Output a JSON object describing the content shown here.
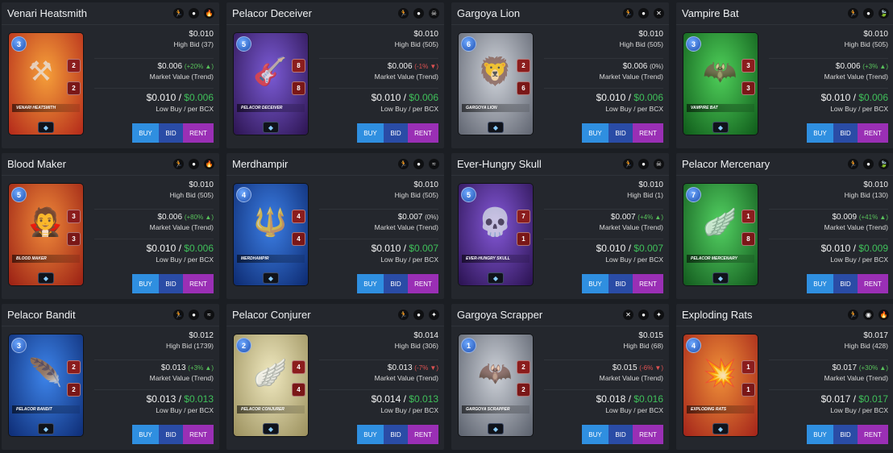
{
  "labels": {
    "high_bid": "High Bid",
    "market_value": "Market Value (Trend)",
    "low_buy": "Low Buy / per BCX",
    "buy": "BUY",
    "bid": "BID",
    "rent": "RENT"
  },
  "colors": {
    "background": "#1b1e23",
    "panel": "#24272d",
    "trend_up": "#58c25b",
    "trend_down": "#e05252",
    "buy": "#2f8fe0",
    "bid": "#2a4ca6",
    "rent": "#9a2fb5"
  },
  "cards": [
    {
      "name": "Venari Heatsmith",
      "art_label": "VENARI HEATSMITH",
      "mana": "3",
      "attack": "2",
      "health": "2",
      "element": "fire",
      "frame": [
        "#f6a03a",
        "#b3281a"
      ],
      "glyph": "⚒",
      "icons": [
        "runner-icon",
        "shield-icon",
        "fire-icon"
      ],
      "price": "$0.010",
      "high_bid": "High Bid (37)",
      "market_value": "$0.006",
      "trend": "(+20% ▲)",
      "trend_dir": "up",
      "low_buy": "$0.010 /",
      "low_buy_bcx": "$0.006"
    },
    {
      "name": "Pelacor Deceiver",
      "art_label": "PELACOR DECEIVER",
      "mana": "5",
      "attack": "8",
      "health": "8",
      "element": "death",
      "frame": [
        "#7b5bd6",
        "#2c1450"
      ],
      "glyph": "🎸",
      "icons": [
        "runner-icon",
        "shield-icon",
        "death-icon"
      ],
      "price": "$0.010",
      "high_bid": "High Bid (505)",
      "market_value": "$0.006",
      "trend": "(-1% ▼)",
      "trend_dir": "down",
      "low_buy": "$0.010 /",
      "low_buy_bcx": "$0.006"
    },
    {
      "name": "Gargoya Lion",
      "art_label": "GARGOYA LION",
      "mana": "6",
      "attack": "2",
      "health": "6",
      "element": "neutral",
      "frame": [
        "#cfd3da",
        "#5f6470"
      ],
      "glyph": "🦁",
      "icons": [
        "runner-icon",
        "shield-icon",
        "neutral-icon"
      ],
      "price": "$0.010",
      "high_bid": "High Bid (505)",
      "market_value": "$0.006",
      "trend": "(0%)",
      "trend_dir": "flat",
      "low_buy": "$0.010 /",
      "low_buy_bcx": "$0.006"
    },
    {
      "name": "Vampire Bat",
      "art_label": "VAMPIRE BAT",
      "mana": "3",
      "attack": "3",
      "health": "3",
      "element": "earth",
      "frame": [
        "#4fd05a",
        "#0f5a1a"
      ],
      "glyph": "🦇",
      "icons": [
        "runner-icon",
        "shield-icon",
        "earth-icon"
      ],
      "price": "$0.010",
      "high_bid": "High Bid (505)",
      "market_value": "$0.006",
      "trend": "(+3% ▲)",
      "trend_dir": "up",
      "low_buy": "$0.010 /",
      "low_buy_bcx": "$0.006"
    },
    {
      "name": "Blood Maker",
      "art_label": "BLOOD MAKER",
      "mana": "5",
      "attack": "3",
      "health": "3",
      "element": "fire",
      "frame": [
        "#f08a3a",
        "#9a1f14"
      ],
      "glyph": "🧛",
      "icons": [
        "runner-icon",
        "shield-icon",
        "fire-icon"
      ],
      "price": "$0.010",
      "high_bid": "High Bid (505)",
      "market_value": "$0.006",
      "trend": "(+80% ▲)",
      "trend_dir": "up",
      "low_buy": "$0.010 /",
      "low_buy_bcx": "$0.006"
    },
    {
      "name": "Merdhampir",
      "art_label": "MERDHAMPIR",
      "mana": "4",
      "attack": "4",
      "health": "4",
      "element": "water",
      "frame": [
        "#3c7fe6",
        "#0d2a70"
      ],
      "glyph": "🔱",
      "icons": [
        "runner-icon",
        "shield-icon",
        "water-icon"
      ],
      "price": "$0.010",
      "high_bid": "High Bid (505)",
      "market_value": "$0.007",
      "trend": "(0%)",
      "trend_dir": "flat",
      "low_buy": "$0.010 /",
      "low_buy_bcx": "$0.007"
    },
    {
      "name": "Ever-Hungry Skull",
      "art_label": "EVER-HUNGRY SKULL",
      "mana": "5",
      "attack": "7",
      "health": "1",
      "element": "death",
      "frame": [
        "#8458d8",
        "#2a1250"
      ],
      "glyph": "💀",
      "icons": [
        "runner-icon",
        "shield-icon",
        "death-icon"
      ],
      "price": "$0.010",
      "high_bid": "High Bid (1)",
      "market_value": "$0.007",
      "trend": "(+4% ▲)",
      "trend_dir": "up",
      "low_buy": "$0.010 /",
      "low_buy_bcx": "$0.007"
    },
    {
      "name": "Pelacor Mercenary",
      "art_label": "PELACOR MERCENARY",
      "mana": "7",
      "attack": "1",
      "health": "8",
      "element": "earth",
      "frame": [
        "#53d162",
        "#12591d"
      ],
      "glyph": "🪽",
      "icons": [
        "runner-icon",
        "shield-icon",
        "earth-icon"
      ],
      "price": "$0.010",
      "high_bid": "High Bid (130)",
      "market_value": "$0.009",
      "trend": "(+41% ▲)",
      "trend_dir": "up",
      "low_buy": "$0.010 /",
      "low_buy_bcx": "$0.009"
    },
    {
      "name": "Pelacor Bandit",
      "art_label": "PELACOR BANDIT",
      "mana": "3",
      "attack": "2",
      "health": "2",
      "element": "water",
      "frame": [
        "#3d84ea",
        "#0e2c74"
      ],
      "glyph": "🪶",
      "icons": [
        "runner-icon",
        "shield-icon",
        "water-icon"
      ],
      "price": "$0.012",
      "high_bid": "High Bid (1739)",
      "market_value": "$0.013",
      "trend": "(+3% ▲)",
      "trend_dir": "up",
      "low_buy": "$0.013 /",
      "low_buy_bcx": "$0.013"
    },
    {
      "name": "Pelacor Conjurer",
      "art_label": "PELACOR CONJURER",
      "mana": "2",
      "attack": "4",
      "health": "4",
      "element": "life",
      "frame": [
        "#f0e9c0",
        "#9a8f5c"
      ],
      "glyph": "🪽",
      "icons": [
        "runner-icon",
        "shield-icon",
        "life-icon"
      ],
      "price": "$0.014",
      "high_bid": "High Bid (306)",
      "market_value": "$0.013",
      "trend": "(-7% ▼)",
      "trend_dir": "down",
      "low_buy": "$0.014 /",
      "low_buy_bcx": "$0.013"
    },
    {
      "name": "Gargoya Scrapper",
      "art_label": "GARGOYA SCRAPPER",
      "mana": "1",
      "attack": "2",
      "health": "2",
      "element": "neutral",
      "frame": [
        "#cdd1d8",
        "#5a606c"
      ],
      "glyph": "🦇",
      "icons": [
        "neutral-icon",
        "shield-icon",
        "life-icon"
      ],
      "price": "$0.015",
      "high_bid": "High Bid (68)",
      "market_value": "$0.015",
      "trend": "(-6% ▼)",
      "trend_dir": "down",
      "low_buy": "$0.018 /",
      "low_buy_bcx": "$0.016"
    },
    {
      "name": "Exploding Rats",
      "art_label": "EXPLODING RATS",
      "mana": "4",
      "attack": "1",
      "health": "1",
      "element": "fire",
      "frame": [
        "#f09038",
        "#a3231a"
      ],
      "glyph": "💥",
      "icons": [
        "runner-icon",
        "ranged-icon",
        "fire-icon"
      ],
      "price": "$0.017",
      "high_bid": "High Bid (428)",
      "market_value": "$0.017",
      "trend": "(+30% ▲)",
      "trend_dir": "up",
      "low_buy": "$0.017 /",
      "low_buy_bcx": "$0.017"
    }
  ]
}
